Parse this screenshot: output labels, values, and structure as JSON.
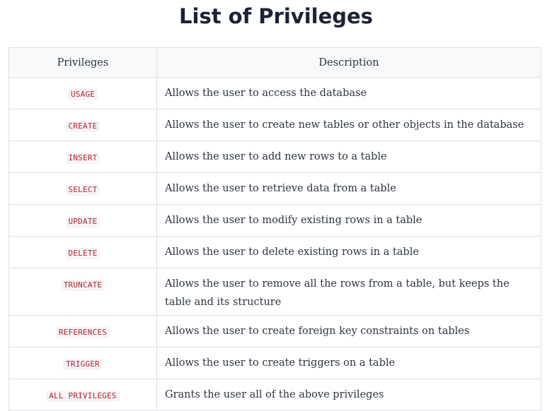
{
  "title": "List of Privileges",
  "table": {
    "headers": [
      "Privileges",
      "Description"
    ],
    "rows": [
      {
        "privilege": "USAGE",
        "description": "Allows the user to access the database"
      },
      {
        "privilege": "CREATE",
        "description": "Allows the user to create new tables or other objects in the database"
      },
      {
        "privilege": "INSERT",
        "description": "Allows the user to add new rows to a table"
      },
      {
        "privilege": "SELECT",
        "description": "Allows the user to retrieve data from a table"
      },
      {
        "privilege": "UPDATE",
        "description": "Allows the user to modify existing rows in a table"
      },
      {
        "privilege": "DELETE",
        "description": "Allows the user to delete existing rows in a table"
      },
      {
        "privilege": "TRUNCATE",
        "description": "Allows the user to remove all the rows from a table, but keeps the table and its structure"
      },
      {
        "privilege": "REFERENCES",
        "description": "Allows the user to create foreign key constraints on tables"
      },
      {
        "privilege": "TRIGGER",
        "description": "Allows the user to create triggers on a table"
      },
      {
        "privilege": "ALL PRIVILEGES",
        "description": "Grants the user all of the above privileges"
      }
    ]
  },
  "colors": {
    "title": "#1b2233",
    "code_text": "#b5232f",
    "code_background": "#f4f4f6",
    "border": "#dcdfe4"
  }
}
